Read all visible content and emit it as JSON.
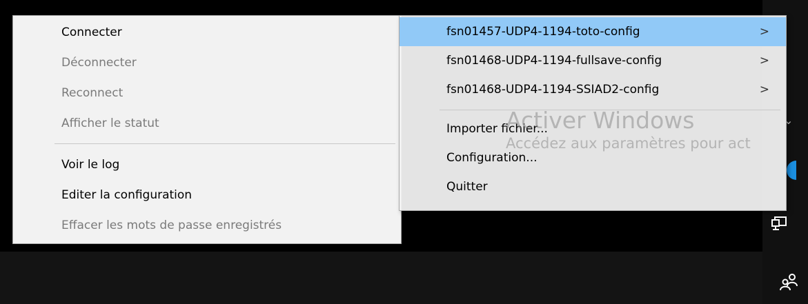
{
  "left_menu": {
    "items": [
      {
        "label": "Connecter",
        "enabled": true
      },
      {
        "label": "Déconnecter",
        "enabled": false
      },
      {
        "label": "Reconnect",
        "enabled": false
      },
      {
        "label": "Afficher le statut",
        "enabled": false
      },
      {
        "label": "Voir le log",
        "enabled": true
      },
      {
        "label": "Editer la configuration",
        "enabled": true
      },
      {
        "label": "Effacer les mots de passe enregistrés",
        "enabled": false
      }
    ]
  },
  "right_menu": {
    "configs": [
      {
        "label": "fsn01457-UDP4-1194-toto-config",
        "highlighted": true,
        "submenu_glyph": ">"
      },
      {
        "label": "fsn01468-UDP4-1194-fullsave-config",
        "highlighted": false,
        "submenu_glyph": ">"
      },
      {
        "label": "fsn01468-UDP4-1194-SSIAD2-config",
        "highlighted": false,
        "submenu_glyph": ">"
      }
    ],
    "actions": [
      {
        "label": "Importer fichier..."
      },
      {
        "label": "Configuration..."
      },
      {
        "label": "Quitter"
      }
    ]
  },
  "watermark": {
    "title": "Activer Windows",
    "subtitle": "Accédez aux paramètres pour act"
  },
  "tray": {
    "chevron_glyph": "⌄",
    "icons": [
      "network-icon",
      "people-icon",
      "chevron-up-icon"
    ]
  },
  "colors": {
    "highlight": "#91c9f7",
    "menu_background": "#f2f2f2",
    "disabled_text": "#7a7a7a",
    "desktop": "#000000"
  }
}
